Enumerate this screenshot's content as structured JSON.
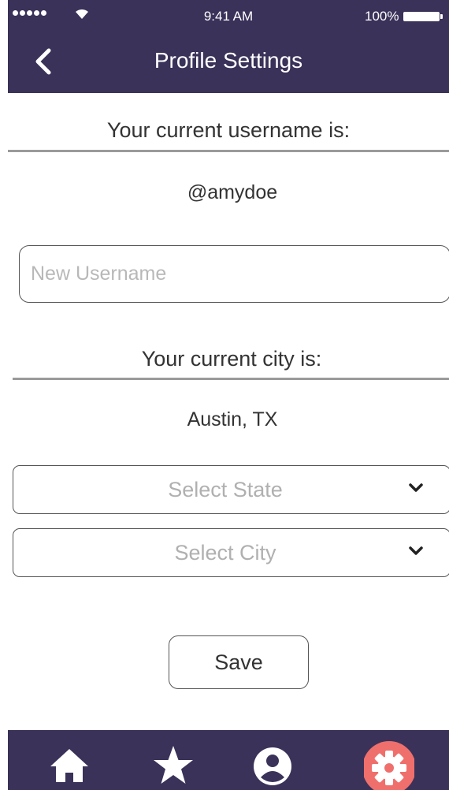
{
  "status_bar": {
    "time": "9:41 AM",
    "battery": "100%",
    "icons": [
      "signal-dots-icon",
      "wifi-icon",
      "battery-icon"
    ]
  },
  "nav": {
    "title": "Profile Settings",
    "back_icon": "chevron-left-icon"
  },
  "username": {
    "label": "Your current username is:",
    "current": "@amydoe",
    "input_placeholder": "New Username",
    "input_value": ""
  },
  "city": {
    "label": "Your current city is:",
    "current": "Austin, TX",
    "state_select": "Select State",
    "city_select": "Select City",
    "dropdown_icon": "chevron-down-icon"
  },
  "actions": {
    "save_label": "Save"
  },
  "tab_bar": {
    "tabs": [
      {
        "icon": "home-icon",
        "active": false
      },
      {
        "icon": "star-icon",
        "active": false
      },
      {
        "icon": "user-circle-icon",
        "active": false
      },
      {
        "icon": "gear-icon",
        "active": true
      }
    ],
    "active_color": "#ef6f6c",
    "icon_color": "#ffffff"
  },
  "colors": {
    "header_bg": "#3a3259",
    "divider": "#9a9a9a",
    "placeholder": "#b0b0b0"
  }
}
